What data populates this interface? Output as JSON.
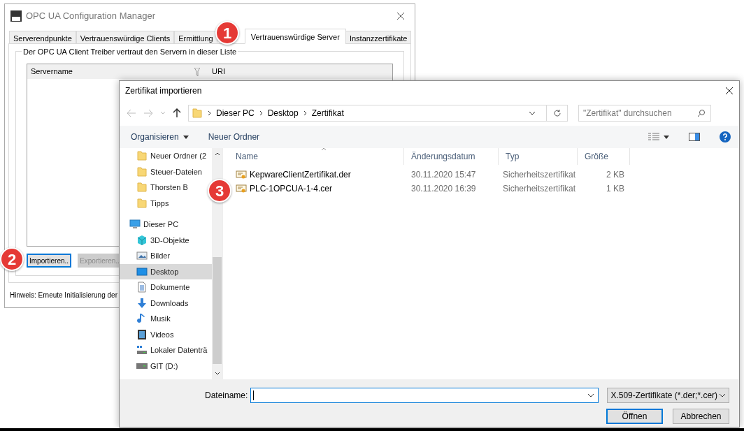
{
  "background_window": {
    "title": "OPC UA Configuration Manager",
    "tabs": [
      {
        "label": "Serverendpunkte",
        "selected": false
      },
      {
        "label": "Vertrauenswürdige Clients",
        "selected": false
      },
      {
        "label": "Ermittlung",
        "selected": false
      },
      {
        "label": "Vertrauenswürdige Server",
        "selected": true
      },
      {
        "label": "Instanzzertifikate",
        "selected": false
      }
    ],
    "group_label": "Der OPC UA Client Treiber vertraut den Servern in dieser Liste",
    "table": {
      "columns": [
        "Servername",
        "URI"
      ]
    },
    "buttons": [
      {
        "label": "Importieren..",
        "disabled": false,
        "focused": true
      },
      {
        "label": "Exportieren..",
        "disabled": true,
        "focused": false
      }
    ],
    "hint": "Hinweis: Erneute Initialisierung der"
  },
  "dialog": {
    "title": "Zertifikat importieren",
    "path": [
      "Dieser PC",
      "Desktop",
      "Zertifikat"
    ],
    "search": {
      "placeholder": "\"Zertifikat\" durchsuchen"
    },
    "toolbar": [
      "Organisieren",
      "Neuer Ordner"
    ],
    "nav_pane": {
      "quick_items": [
        {
          "label": "Neuer Ordner (2",
          "kind": "folder",
          "selected": false
        },
        {
          "label": "Steuer-Dateien",
          "kind": "folder",
          "selected": false
        },
        {
          "label": "Thorsten B",
          "kind": "folder",
          "selected": false
        },
        {
          "label": "Tipps",
          "kind": "folder",
          "selected": false
        }
      ],
      "items": [
        {
          "label": "Dieser PC",
          "kind": "pc",
          "selected": false,
          "children": [
            {
              "label": "3D-Objekte",
              "kind": "cube",
              "selected": false
            },
            {
              "label": "Bilder",
              "kind": "pictures",
              "selected": false
            },
            {
              "label": "Desktop",
              "kind": "desktop",
              "selected": true
            },
            {
              "label": "Dokumente",
              "kind": "documents",
              "selected": false
            },
            {
              "label": "Downloads",
              "kind": "downloads",
              "selected": false
            },
            {
              "label": "Musik",
              "kind": "music",
              "selected": false
            },
            {
              "label": "Videos",
              "kind": "videos",
              "selected": false
            },
            {
              "label": "Lokaler Datenträ",
              "kind": "drive-windows",
              "selected": false
            },
            {
              "label": "GIT (D:)",
              "kind": "drive",
              "selected": false
            }
          ]
        }
      ]
    },
    "file_list": {
      "columns": [
        "Name",
        "Änderungsdatum",
        "Typ",
        "Größe"
      ],
      "rows": [
        {
          "name": "KepwareClientZertifikat.der",
          "date": "30.11.2020 15:47",
          "type": "Sicherheitszertifikat",
          "size": "2 KB"
        },
        {
          "name": "PLC-1OPCUA-1-4.cer",
          "date": "30.11.2020 16:39",
          "type": "Sicherheitszertifikat",
          "size": "1 KB"
        }
      ]
    },
    "filename": {
      "label": "Dateiname:"
    },
    "filetype": "X.509-Zertifikate (*.der;*.cer)",
    "buttons": [
      {
        "label": "Öffnen",
        "default": true
      },
      {
        "label": "Abbrechen",
        "default": false
      }
    ]
  },
  "callouts": [
    "1",
    "2",
    "3"
  ]
}
